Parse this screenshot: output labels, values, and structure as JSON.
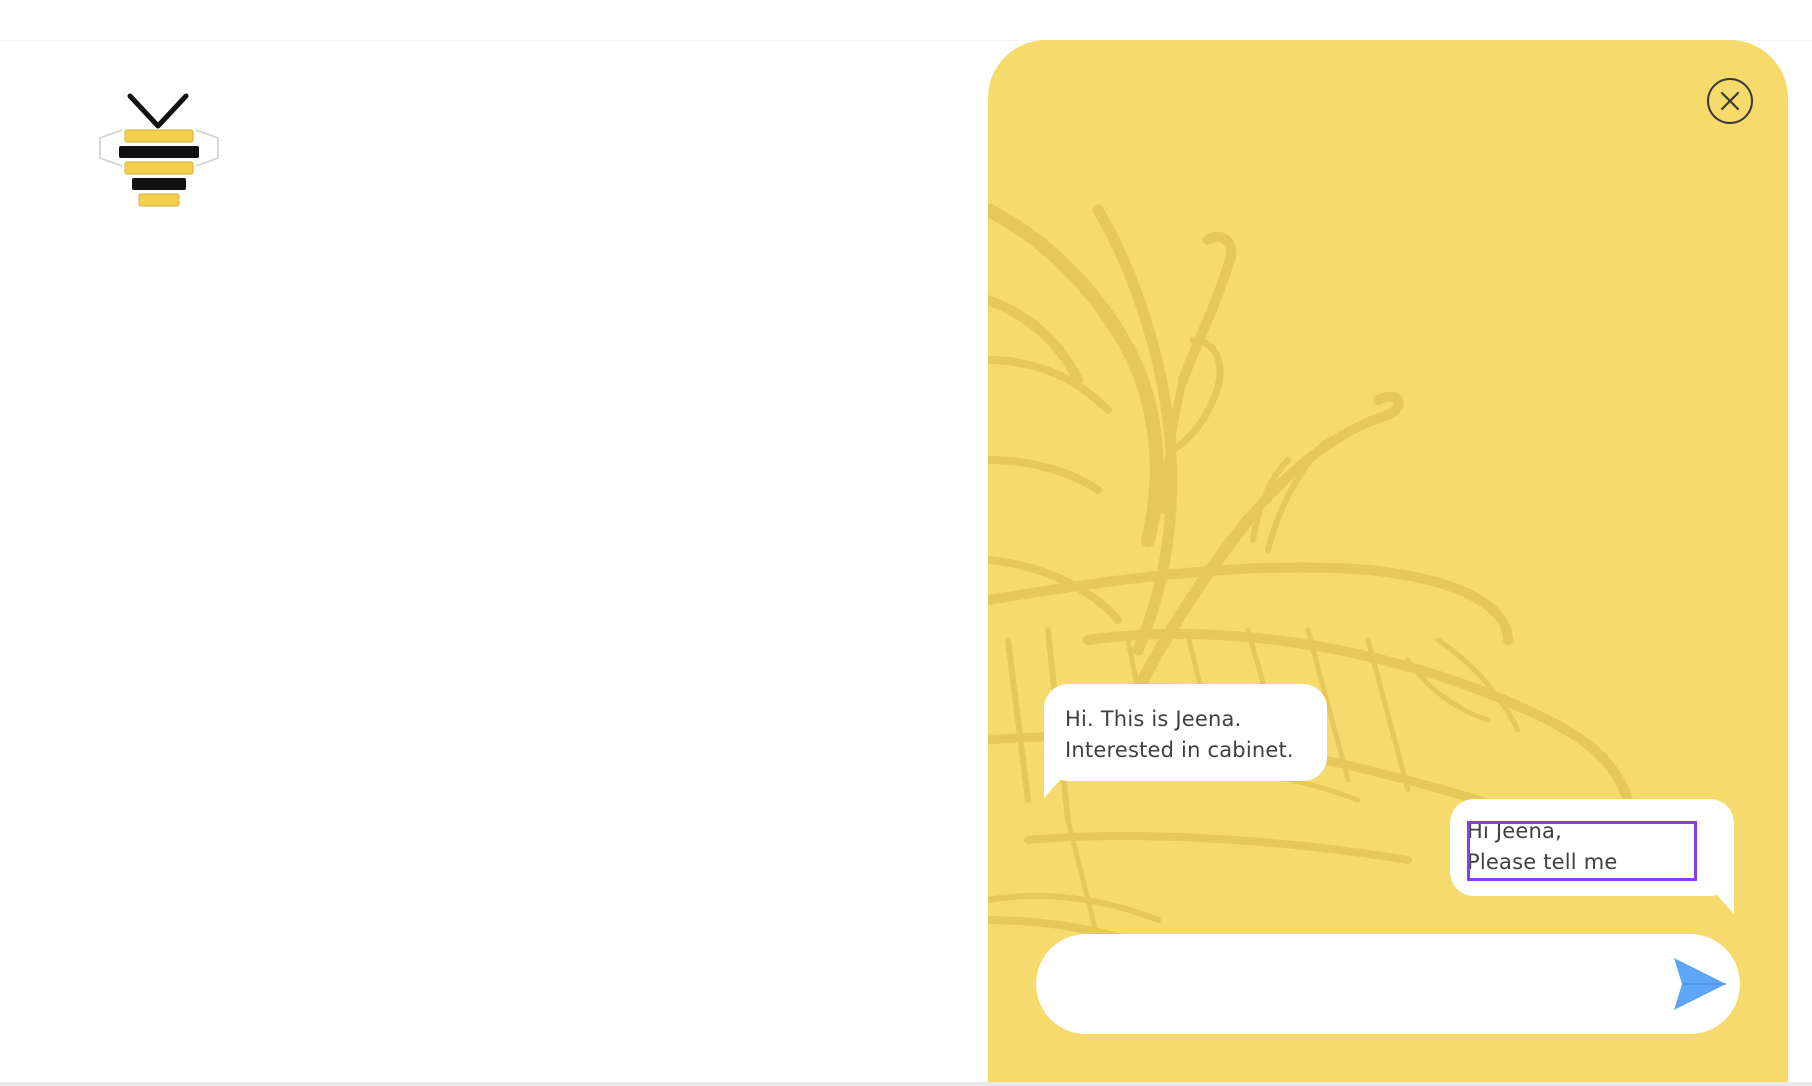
{
  "page": {
    "background": "#ffffff"
  },
  "logo": {
    "icon": "bee-logo-icon",
    "colors": {
      "yellow": "#f2d24c",
      "black": "#111111"
    }
  },
  "chat": {
    "panel_color": "#f6da6b",
    "art_color": "#e6c85a",
    "close_icon": "close-icon",
    "messages": [
      {
        "sender": "visitor",
        "lines": [
          "Hi. This is Jeena.",
          "Interested in cabinet."
        ]
      },
      {
        "sender": "agent",
        "lines": [
          "Hi Jeena,",
          "Please tell me"
        ]
      }
    ],
    "highlight_color": "#8a3cf0",
    "input": {
      "value": "",
      "placeholder": ""
    },
    "send_icon": "send-icon",
    "send_color": "#5ea7f7"
  }
}
